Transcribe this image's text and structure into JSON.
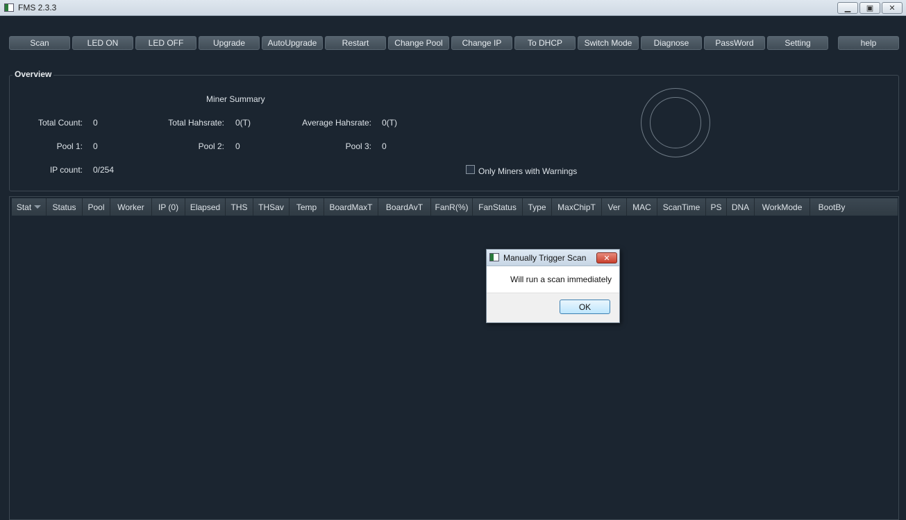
{
  "window": {
    "title": "FMS 2.3.3",
    "minimize_glyph": "▁",
    "maximize_glyph": "▣",
    "close_glyph": "✕"
  },
  "toolbar": {
    "scan": "Scan",
    "led_on": "LED ON",
    "led_off": "LED OFF",
    "upgrade": "Upgrade",
    "autoupgrade": "AutoUpgrade",
    "restart": "Restart",
    "change_pool": "Change Pool",
    "change_ip": "Change IP",
    "to_dhcp": "To DHCP",
    "switch_mode": "Switch Mode",
    "diagnose": "Diagnose",
    "password": "PassWord",
    "setting": "Setting",
    "help": "help"
  },
  "overview": {
    "title": "Overview",
    "summary_title": "Miner Summary",
    "total_count_label": "Total Count:",
    "total_count_value": "0",
    "total_hashrate_label": "Total Hahsrate:",
    "total_hashrate_value": "0(T)",
    "average_hashrate_label": "Average Hahsrate:",
    "average_hashrate_value": "0(T)",
    "pool1_label": "Pool 1:",
    "pool1_value": "0",
    "pool2_label": "Pool 2:",
    "pool2_value": "0",
    "pool3_label": "Pool 3:",
    "pool3_value": "0",
    "ip_count_label": "IP count:",
    "ip_count_value": "0/254",
    "warnings_checkbox_label": "Only Miners with Warnings"
  },
  "table": {
    "columns": [
      "Stat",
      "Status",
      "Pool",
      "Worker",
      "IP (0)",
      "Elapsed",
      "THS",
      "THSav",
      "Temp",
      "BoardMaxT",
      "BoardAvT",
      "FanR(%)",
      "FanStatus",
      "Type",
      "MaxChipT",
      "Ver",
      "MAC",
      "ScanTime",
      "PS",
      "DNA",
      "WorkMode",
      "BootBy"
    ]
  },
  "dialog": {
    "title": "Manually Trigger Scan",
    "close_glyph": "✕",
    "message": "Will run a scan immediately",
    "ok_label": "OK"
  }
}
